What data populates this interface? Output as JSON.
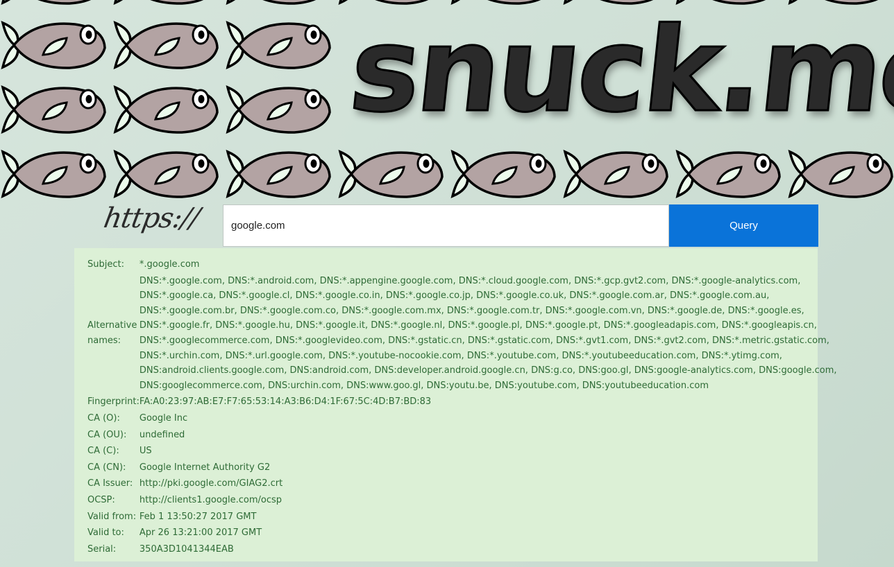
{
  "header": {
    "logo_text": "snuck.me",
    "icon": "fish-icon"
  },
  "query": {
    "protocol_label": "https://",
    "input_value": "google.com",
    "button_label": "Query"
  },
  "certificate": {
    "subject_label": "Subject:",
    "subject_value": "*.google.com",
    "alt_names_label": "Alternative names:",
    "alt_names_lines": [
      "DNS:*.google.com, DNS:*.android.com, DNS:*.appengine.google.com, DNS:*.cloud.google.com, DNS:*.gcp.gvt2.com, DNS:*.google-analytics.com,",
      "DNS:*.google.ca, DNS:*.google.cl, DNS:*.google.co.in, DNS:*.google.co.jp, DNS:*.google.co.uk, DNS:*.google.com.ar, DNS:*.google.com.au,",
      "DNS:*.google.com.br, DNS:*.google.com.co, DNS:*.google.com.mx, DNS:*.google.com.tr, DNS:*.google.com.vn, DNS:*.google.de, DNS:*.google.es,",
      "DNS:*.google.fr, DNS:*.google.hu, DNS:*.google.it, DNS:*.google.nl, DNS:*.google.pl, DNS:*.google.pt, DNS:*.googleadapis.com, DNS:*.googleapis.cn,",
      "DNS:*.googlecommerce.com, DNS:*.googlevideo.com, DNS:*.gstatic.cn, DNS:*.gstatic.com, DNS:*.gvt1.com, DNS:*.gvt2.com, DNS:*.metric.gstatic.com,",
      "DNS:*.urchin.com, DNS:*.url.google.com, DNS:*.youtube-nocookie.com, DNS:*.youtube.com, DNS:*.youtubeeducation.com, DNS:*.ytimg.com,",
      "DNS:android.clients.google.com, DNS:android.com, DNS:developer.android.google.cn, DNS:g.co, DNS:goo.gl, DNS:google-analytics.com, DNS:google.com,",
      "DNS:googlecommerce.com, DNS:urchin.com, DNS:www.goo.gl, DNS:youtu.be, DNS:youtube.com, DNS:youtubeeducation.com"
    ],
    "fields": [
      {
        "label": "Fingerprint:",
        "value": "FA:A0:23:97:AB:E7:F7:65:53:14:A3:B6:D4:1F:67:5C:4D:B7:BD:83"
      },
      {
        "label": "CA (O):",
        "value": "Google Inc"
      },
      {
        "label": "CA (OU):",
        "value": "undefined"
      },
      {
        "label": "CA (C):",
        "value": "US"
      },
      {
        "label": "CA (CN):",
        "value": "Google Internet Authority G2"
      },
      {
        "label": "CA Issuer:",
        "value": "http://pki.google.com/GIAG2.crt"
      },
      {
        "label": "OCSP:",
        "value": "http://clients1.google.com/ocsp"
      },
      {
        "label": "Valid from:",
        "value": "Feb 1 13:50:27 2017 GMT"
      },
      {
        "label": "Valid to:",
        "value": "Apr 26 13:21:00 2017 GMT"
      },
      {
        "label": "Serial:",
        "value": "350A3D1041344EAB"
      }
    ]
  },
  "colors": {
    "background": "#cfe0d6",
    "panel": "#dcf0d6",
    "text": "#2e6b36",
    "button": "#0a73d9",
    "fish_body": "#b3a3a3",
    "fish_fin": "#ecfbec"
  }
}
